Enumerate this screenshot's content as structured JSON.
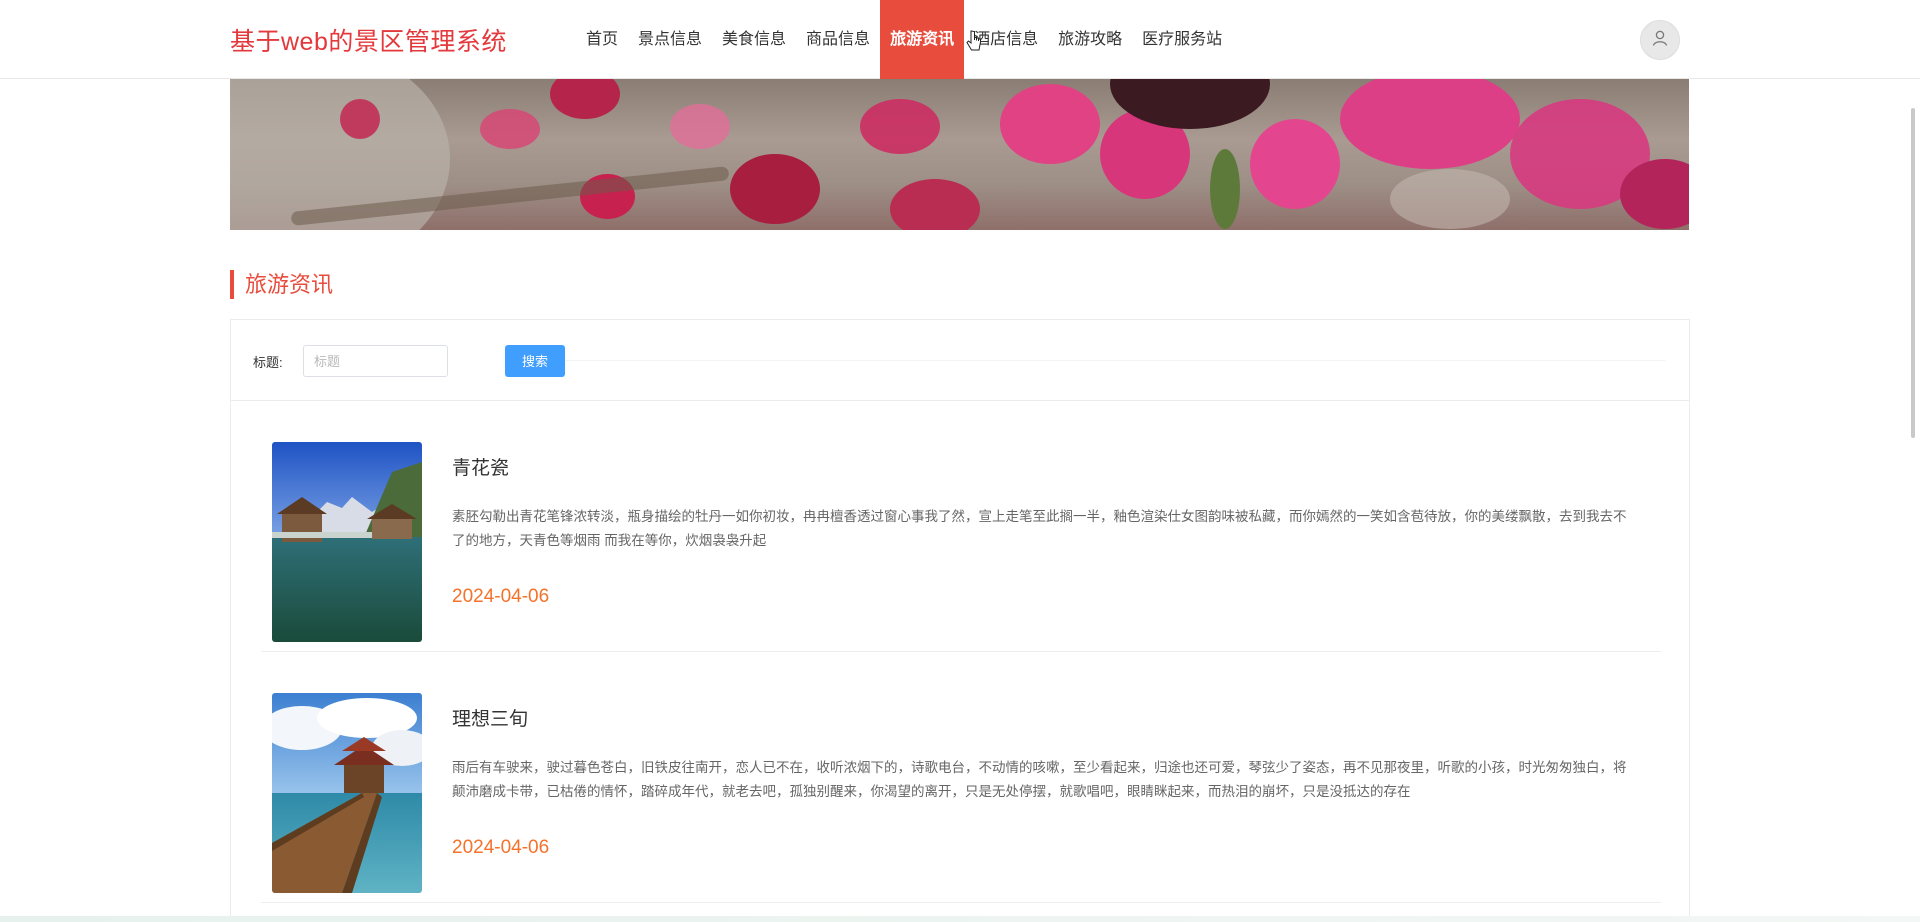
{
  "header": {
    "site_title": "基于web的景区管理系统",
    "nav": [
      {
        "label": "首页",
        "active": false
      },
      {
        "label": "景点信息",
        "active": false
      },
      {
        "label": "美食信息",
        "active": false
      },
      {
        "label": "商品信息",
        "active": false
      },
      {
        "label": "旅游资讯",
        "active": true
      },
      {
        "label": "酒店信息",
        "active": false
      },
      {
        "label": "旅游攻略",
        "active": false
      },
      {
        "label": "医疗服务站",
        "active": false
      }
    ],
    "avatar_icon": "user-icon"
  },
  "section": {
    "title": "旅游资讯"
  },
  "search": {
    "label": "标题:",
    "placeholder": "标题",
    "button_label": "搜索"
  },
  "articles": [
    {
      "title": "青花瓷",
      "summary": "素胚勾勒出青花笔锋浓转淡，瓶身描绘的牡丹一如你初妆，冉冉檀香透过窗心事我了然，宣上走笔至此搁一半，釉色渲染仕女图韵味被私藏，而你嫣然的一笑如含苞待放，你的美缕飘散，去到我去不了的地方，天青色等烟雨 而我在等你，炊烟袅袅升起",
      "date": "2024-04-06"
    },
    {
      "title": "理想三旬",
      "summary": "雨后有车驶来，驶过暮色苍白，旧铁皮往南开，恋人已不在，收听浓烟下的，诗歌电台，不动情的咳嗽，至少看起来，归途也还可爱，琴弦少了姿态，再不见那夜里，听歌的小孩，时光匆匆独白，将颠沛磨成卡带，已枯倦的情怀，踏碎成年代，就老去吧，孤独别醒来，你渴望的离开，只是无处停摆，就歌唱吧，眼睛眯起来，而热泪的崩坏，只是没抵达的存在",
      "date": "2024-04-06"
    }
  ],
  "colors": {
    "accent": "#e84c3d",
    "site_title": "#e4393c",
    "date": "#f5722b",
    "search_button": "#409eff"
  }
}
